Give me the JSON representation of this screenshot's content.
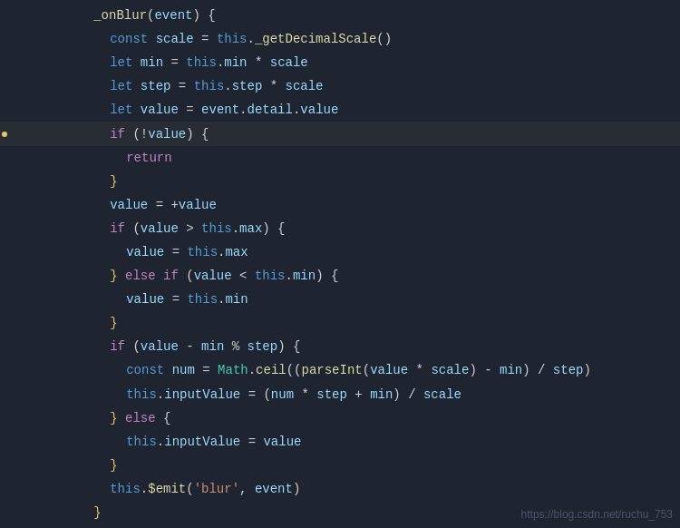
{
  "editor": {
    "background": "#1e2430",
    "watermark": "https://blog.csdn.net/ruchu_753"
  },
  "lines": [
    {
      "num": "",
      "content": "_onBlur(event) {",
      "type": "function-def",
      "highlight": false
    },
    {
      "num": "",
      "content": "  const scale = this._getDecimalScale()",
      "type": "code",
      "highlight": false
    },
    {
      "num": "",
      "content": "  let min = this.min * scale",
      "type": "code",
      "highlight": false
    },
    {
      "num": "",
      "content": "  let step = this.step * scale",
      "type": "code",
      "highlight": false
    },
    {
      "num": "",
      "content": "  let value = event.detail.value",
      "type": "code",
      "highlight": false
    },
    {
      "num": "",
      "content": "  if (!value) {",
      "type": "code",
      "highlight": true
    },
    {
      "num": "",
      "content": "    return",
      "type": "code",
      "highlight": false
    },
    {
      "num": "",
      "content": "  }",
      "type": "code",
      "highlight": false
    },
    {
      "num": "",
      "content": "  value = +value",
      "type": "code",
      "highlight": false
    },
    {
      "num": "",
      "content": "  if (value > this.max) {",
      "type": "code",
      "highlight": false
    },
    {
      "num": "",
      "content": "    value = this.max",
      "type": "code",
      "highlight": false
    },
    {
      "num": "",
      "content": "  } else if (value < this.min) {",
      "type": "code",
      "highlight": false
    },
    {
      "num": "",
      "content": "    value = this.min",
      "type": "code",
      "highlight": false
    },
    {
      "num": "",
      "content": "  }",
      "type": "code",
      "highlight": false
    },
    {
      "num": "",
      "content": "  if (value - min % step) {",
      "type": "code",
      "highlight": false
    },
    {
      "num": "",
      "content": "    const num = Math.ceil((parseInt(value * scale) - min) / step)",
      "type": "code",
      "highlight": false
    },
    {
      "num": "",
      "content": "    this.inputValue = (num * step + min) / scale",
      "type": "code",
      "highlight": false
    },
    {
      "num": "",
      "content": "  } else {",
      "type": "code",
      "highlight": false
    },
    {
      "num": "",
      "content": "    this.inputValue = value",
      "type": "code",
      "highlight": false
    },
    {
      "num": "",
      "content": "  }",
      "type": "code",
      "highlight": false
    },
    {
      "num": "",
      "content": "  this.$emit('blur', event)",
      "type": "code",
      "highlight": false
    },
    {
      "num": "",
      "content": "}",
      "type": "code",
      "highlight": false
    }
  ]
}
